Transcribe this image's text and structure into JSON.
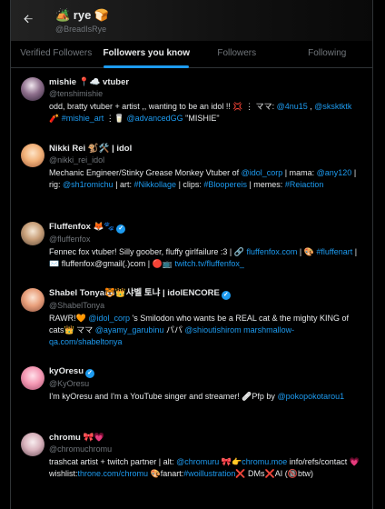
{
  "header": {
    "name": "🏕️ rye 🍞",
    "handle": "@BreadIsRye"
  },
  "tabs": [
    {
      "label": "Verified Followers"
    },
    {
      "label": "Followers you know"
    },
    {
      "label": "Followers"
    },
    {
      "label": "Following"
    }
  ],
  "users": [
    {
      "name": "mishie 📍☁️ vtuber",
      "handle": "@tenshimishie",
      "bio": [
        {
          "t": "odd, bratty vtuber + artist ,, wanting to be an idol !! 💢 ⋮ ママ: "
        },
        {
          "t": "@4nu15",
          "link": true
        },
        {
          "t": " , "
        },
        {
          "t": "@sksktktk",
          "link": true
        },
        {
          "t": " 🧨 "
        },
        {
          "t": "#mishie_art",
          "link": true
        },
        {
          "t": " ⋮🥛 "
        },
        {
          "t": "@advancedGG",
          "link": true
        },
        {
          "t": " \"MISHIE\""
        }
      ]
    },
    {
      "name": "Nikki Rei 🐒🛠️ | idol",
      "handle": "@nikki_rei_idol",
      "bio": [
        {
          "t": "Mechanic Engineer/Stinky Grease Monkey Vtuber of "
        },
        {
          "t": "@idol_corp",
          "link": true
        },
        {
          "t": " | mama: "
        },
        {
          "t": "@any120",
          "link": true
        },
        {
          "t": " | rig: "
        },
        {
          "t": "@sh1romichu",
          "link": true
        },
        {
          "t": " | art: "
        },
        {
          "t": "#Nikkollage",
          "link": true
        },
        {
          "t": " | clips: "
        },
        {
          "t": "#Bloopereis",
          "link": true
        },
        {
          "t": " | memes: "
        },
        {
          "t": "#Reiaction",
          "link": true
        }
      ]
    },
    {
      "name": "Fluffenfox 🦊🐾",
      "handle": "@fluffenfox",
      "bio": [
        {
          "t": "Fennec fox vtuber! Silly goober, fluffy girlfailure :3 | 🔗 "
        },
        {
          "t": "fluffenfox.com",
          "link": true
        },
        {
          "t": " | 🎨 "
        },
        {
          "t": "#fluffenart",
          "link": true
        },
        {
          "t": " | ✉️ fluffenfox@gmail(.)com | 🔴📺 "
        },
        {
          "t": "twitch.tv/fluffenfox_",
          "link": true
        }
      ]
    },
    {
      "name": "Shabel Tonya🐯👑샤벨 토냐 | idolENCORE",
      "handle": "@ShabelTonya",
      "bio": [
        {
          "t": "RAWR!🧡 "
        },
        {
          "t": "@idol_corp",
          "link": true
        },
        {
          "t": " 's Smilodon who wants be a REAL cat & the mighty KING of cats👑 ママ "
        },
        {
          "t": "@ayamy_garubinu",
          "link": true
        },
        {
          "t": " パパ "
        },
        {
          "t": "@shioutishirom",
          "link": true
        },
        {
          "t": " "
        },
        {
          "t": "marshmallow-qa.com/shabeltonya",
          "link": true
        }
      ]
    },
    {
      "name": "kyOresu",
      "handle": "@KyOresu",
      "bio": [
        {
          "t": "I'm kyOresu and I'm a YouTube singer and streamer! 🩹Pfp by "
        },
        {
          "t": "@pokopokotarou1",
          "link": true
        }
      ]
    },
    {
      "name": "chromu 🎀💗",
      "handle": "@chromuchromu",
      "bio": [
        {
          "t": "trashcat artist + twitch partner | alt: "
        },
        {
          "t": "@chromuru",
          "link": true
        },
        {
          "t": " 🎀👉"
        },
        {
          "t": "chromu.moe",
          "link": true
        },
        {
          "t": " info/refs/contact 💗wishlist:"
        },
        {
          "t": "throne.com/chromu",
          "link": true
        },
        {
          "t": " 🎨fanart:"
        },
        {
          "t": "#woillustration",
          "link": true
        },
        {
          "t": "❌ DMs❌AI (🔞btw)"
        }
      ]
    }
  ],
  "colors": {
    "accent": "#1d9bf0",
    "background": "#000000",
    "text": "#e7e9ea",
    "muted": "#71767b"
  }
}
